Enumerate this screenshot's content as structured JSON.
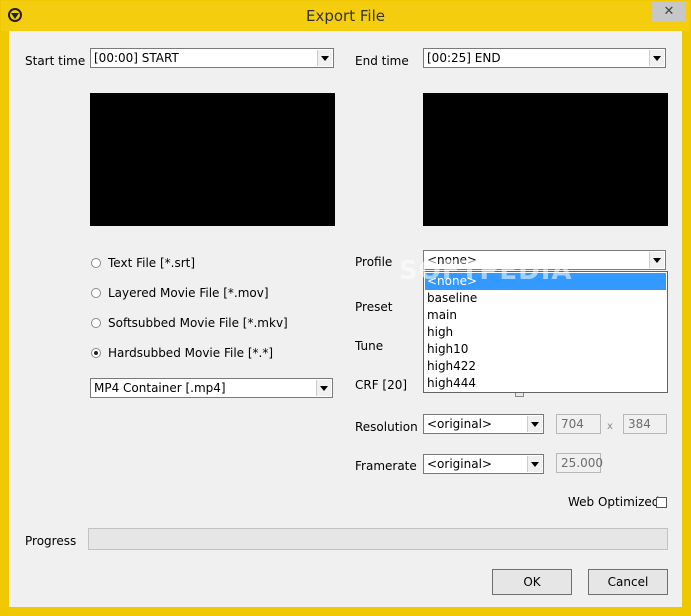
{
  "window": {
    "title": "Export File",
    "close_glyph": "✕",
    "app_icon": "app-logo-icon"
  },
  "start_time": {
    "label": "Start time",
    "value": "[00:00] START"
  },
  "end_time": {
    "label": "End time",
    "value": "[00:25] END"
  },
  "output_types": [
    {
      "label": "Text File [*.srt]",
      "checked": false
    },
    {
      "label": "Layered Movie File [*.mov]",
      "checked": false
    },
    {
      "label": "Softsubbed Movie File [*.mkv]",
      "checked": false
    },
    {
      "label": "Hardsubbed Movie File [*.*]",
      "checked": true
    }
  ],
  "container": {
    "value": "MP4 Container [.mp4]"
  },
  "profile": {
    "label": "Profile",
    "value": "<none>",
    "options": [
      "<none>",
      "baseline",
      "main",
      "high",
      "high10",
      "high422",
      "high444"
    ],
    "selected_index": 0
  },
  "preset": {
    "label": "Preset"
  },
  "tune": {
    "label": "Tune"
  },
  "crf": {
    "label": "CRF [20]",
    "value": 20
  },
  "resolution": {
    "label": "Resolution",
    "value": "<original>",
    "width": "704",
    "separator": "x",
    "height": "384"
  },
  "framerate": {
    "label": "Framerate",
    "value": "<original>",
    "fps": "25.000"
  },
  "web_optimized": {
    "label": "Web Optimized",
    "checked": false
  },
  "progress": {
    "label": "Progress",
    "value": 0
  },
  "buttons": {
    "ok": "OK",
    "cancel": "Cancel"
  },
  "watermark": "SOFTPEDIA",
  "colors": {
    "titlebar": "#f4cd0f",
    "selection": "#3399ff",
    "client": "#f0f0f0"
  }
}
